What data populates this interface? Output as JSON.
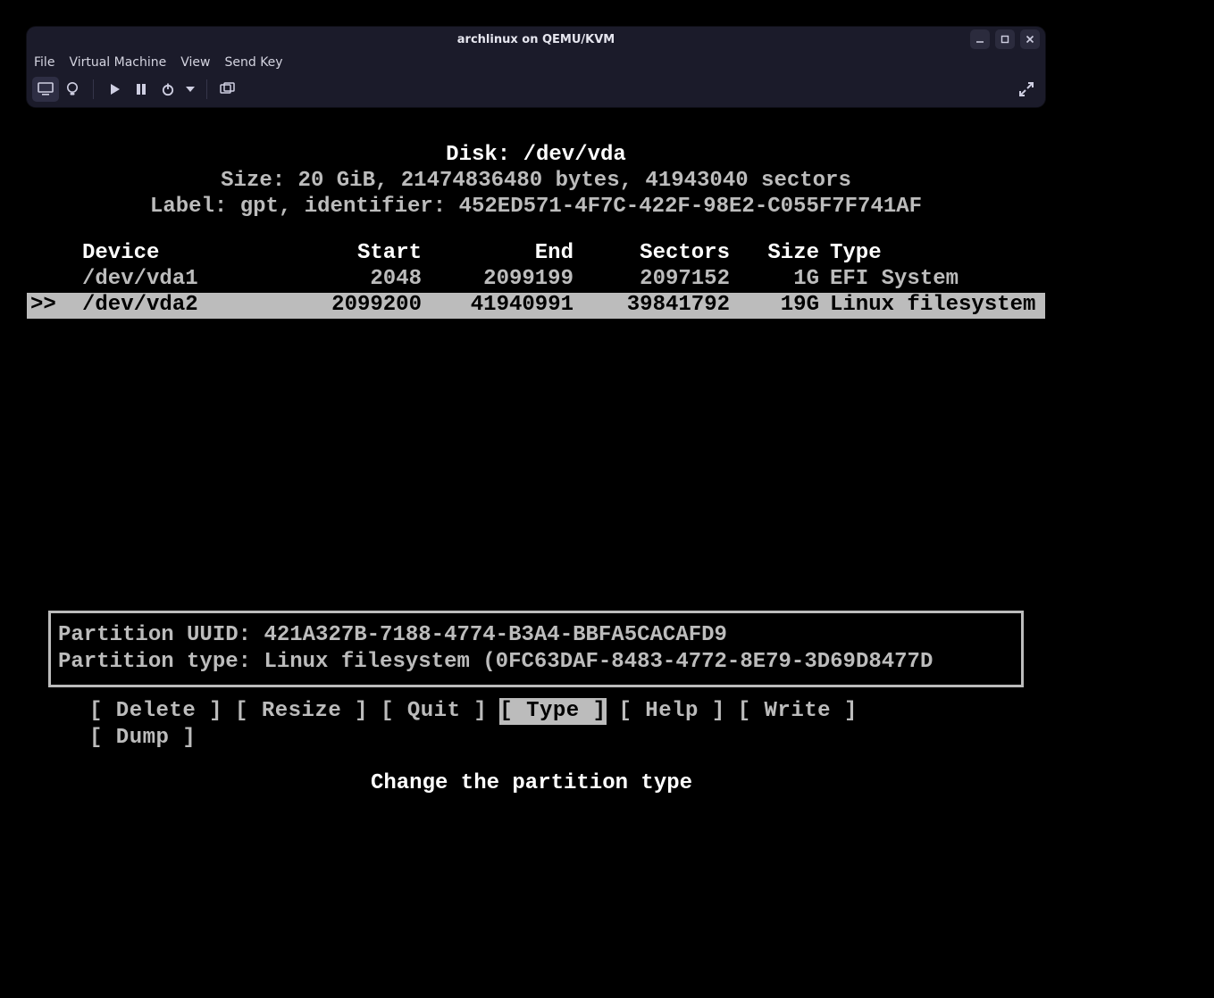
{
  "window": {
    "title": "archlinux on QEMU/KVM",
    "menus": {
      "file": "File",
      "vm": "Virtual Machine",
      "view": "View",
      "sendkey": "Send Key"
    }
  },
  "cfdisk": {
    "disk_line": "Disk: /dev/vda",
    "size_line": "Size: 20 GiB, 21474836480 bytes, 41943040 sectors",
    "label_line": "Label: gpt, identifier: 452ED571-4F7C-422F-98E2-C055F7F741AF",
    "headers": {
      "device": "Device",
      "start": "Start",
      "end": "End",
      "sectors": "Sectors",
      "size": "Size",
      "type": "Type"
    },
    "rows": [
      {
        "selected": false,
        "cursor": "  ",
        "device": "/dev/vda1",
        "start": "2048",
        "end": "2099199",
        "sectors": "2097152",
        "size": "1G",
        "type": "EFI System"
      },
      {
        "selected": true,
        "cursor": ">>",
        "device": "/dev/vda2",
        "start": "2099200",
        "end": "41940991",
        "sectors": "39841792",
        "size": "19G",
        "type": "Linux filesystem"
      }
    ],
    "info": {
      "uuid_line": "Partition UUID: 421A327B-7188-4774-B3A4-BBFA5CACAFD9",
      "type_line": "Partition type: Linux filesystem (0FC63DAF-8483-4772-8E79-3D69D8477D"
    },
    "actions": [
      {
        "label": "Delete",
        "selected": false
      },
      {
        "label": "Resize",
        "selected": false
      },
      {
        "label": "Quit",
        "selected": false
      },
      {
        "label": "Type",
        "selected": true
      },
      {
        "label": "Help",
        "selected": false
      },
      {
        "label": "Write",
        "selected": false
      },
      {
        "label": "Dump",
        "selected": false
      }
    ],
    "hint": "Change the partition type"
  }
}
